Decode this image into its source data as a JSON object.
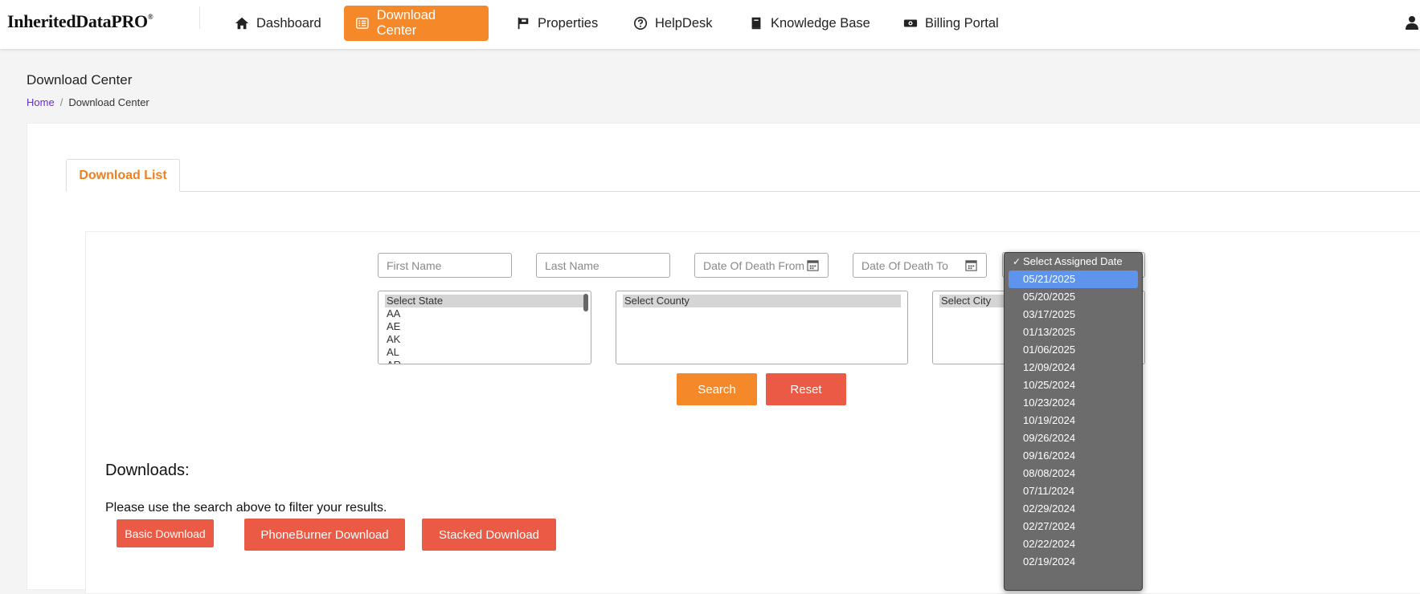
{
  "nav": {
    "brand": "InheritedDataPRO",
    "brand_mark": "®",
    "items": [
      {
        "label": "Dashboard",
        "icon": "home-icon"
      },
      {
        "label": "Download Center",
        "icon": "list-icon",
        "active": true
      },
      {
        "label": "Properties",
        "icon": "flag-icon"
      },
      {
        "label": "HelpDesk",
        "icon": "question-circle-icon"
      },
      {
        "label": "Knowledge Base",
        "icon": "book-icon"
      },
      {
        "label": "Billing Portal",
        "icon": "money-bill-icon"
      }
    ],
    "user_icon": "user-icon"
  },
  "page": {
    "title": "Download Center",
    "breadcrumb": {
      "home": "Home",
      "separator": "/",
      "current": "Download Center"
    }
  },
  "tabs": [
    {
      "label": "Download List",
      "active": true
    }
  ],
  "filters": {
    "first_name_placeholder": "First Name",
    "last_name_placeholder": "Last Name",
    "dod_from_placeholder": "Date Of Death From",
    "dod_to_placeholder": "Date Of Death To",
    "state": {
      "selected": "Select State",
      "options": [
        "AA",
        "AE",
        "AK",
        "AL",
        "AR"
      ]
    },
    "county": {
      "selected": "Select County"
    },
    "city": {
      "selected": "Select City"
    },
    "assigned_date": {
      "selected": "Select Assigned Date",
      "highlighted": "05/21/2025",
      "options": [
        "05/21/2025",
        "05/20/2025",
        "03/17/2025",
        "01/13/2025",
        "01/06/2025",
        "12/09/2024",
        "10/25/2024",
        "10/23/2024",
        "10/19/2024",
        "09/26/2024",
        "09/16/2024",
        "08/08/2024",
        "07/11/2024",
        "02/29/2024",
        "02/27/2024",
        "02/22/2024",
        "02/19/2024"
      ]
    },
    "search_label": "Search",
    "reset_label": "Reset"
  },
  "downloads": {
    "title": "Downloads:",
    "note": "Please use the search above to filter your results.",
    "basic_label": "Basic Download",
    "phoneburner_label": "PhoneBurner Download",
    "stacked_label": "Stacked Download"
  },
  "colors": {
    "accent": "#f5892a",
    "danger": "#eb5a45",
    "highlight": "#5e94ec",
    "link": "#6a2bd6"
  }
}
